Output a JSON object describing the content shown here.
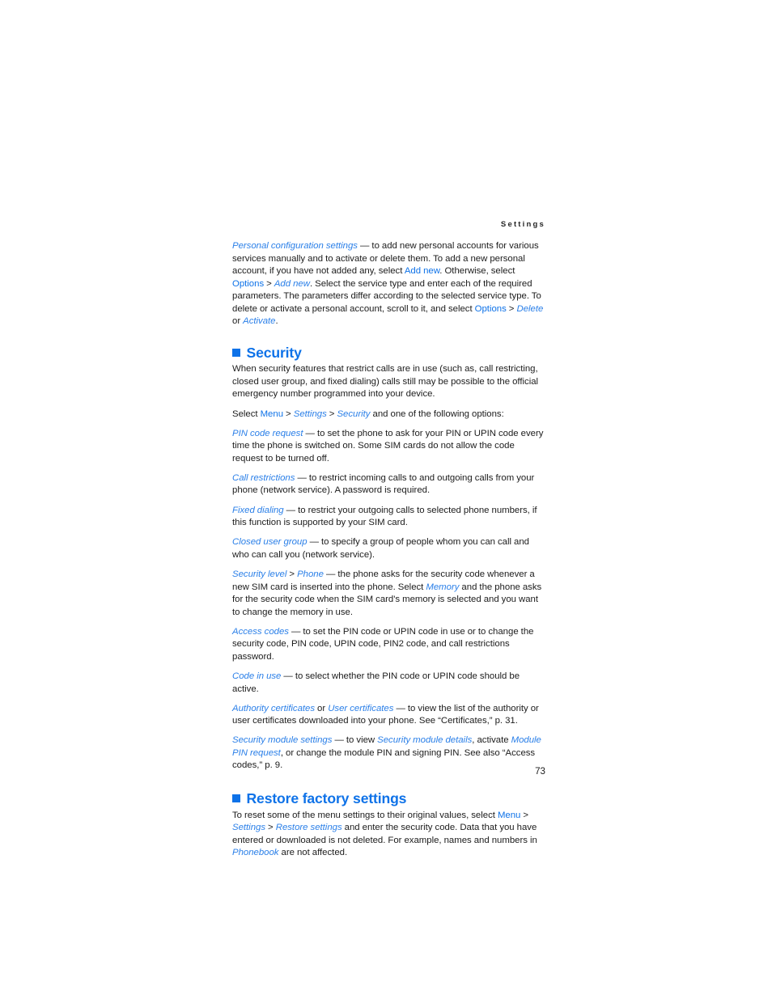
{
  "document": {
    "running_header": "Settings",
    "page_number": "73",
    "accent_color": "#0e72e8",
    "link_color": "#2a7fe8",
    "body_color": "#1c1c1c",
    "background_color": "#ffffff"
  },
  "intro_paragraph": {
    "term": "Personal configuration settings",
    "dash": " — ",
    "text_1": "to add new personal accounts for various services manually and to activate or delete them. To add a new personal account, if you have not added any, select ",
    "softkey_1": "Add new",
    "text_2": ". Otherwise, select ",
    "softkey_2": "Options",
    "sep_1": " > ",
    "menu_1": "Add new",
    "text_3": ". Select the service type and enter each of the required parameters. The parameters differ according to the selected service type. To delete or activate a personal account, scroll to it, and select ",
    "softkey_3": "Options",
    "sep_2": " > ",
    "menu_2": "Delete",
    "text_4": " or ",
    "menu_3": "Activate",
    "text_5": "."
  },
  "security_section": {
    "heading": "Security",
    "intro": "When security features that restrict calls are in use (such as, call restricting, closed user group, and fixed dialing) calls still may be possible to the official emergency number programmed into your device.",
    "path_lead": "Select ",
    "path_menu": "Menu",
    "path_sep_1": " > ",
    "path_settings": "Settings",
    "path_sep_2": " > ",
    "path_security": "Security",
    "path_tail": " and one of the following options:",
    "items": [
      {
        "term": "PIN code request",
        "dash": " — ",
        "text": "to set the phone to ask for your PIN or UPIN code every time the phone is switched on. Some SIM cards do not allow the code request to be turned off."
      },
      {
        "term": "Call restrictions",
        "dash": " — ",
        "text": "to restrict incoming calls to and outgoing calls from your phone (network service). A password is required."
      },
      {
        "term": "Fixed dialing",
        "dash": " — ",
        "text": "to restrict your outgoing calls to selected phone numbers, if this function is supported by your SIM card."
      },
      {
        "term": "Closed user group",
        "dash": " — ",
        "text": "to specify a group of people whom you can call and who can call you (network service)."
      }
    ],
    "security_level": {
      "term": "Security level",
      "sep": " > ",
      "term_2": "Phone",
      "dash": " — ",
      "text_1": "the phone asks for the security code whenever a new SIM card is inserted into the phone. Select ",
      "menu": "Memory",
      "text_2": " and the phone asks for the security code when the SIM card's memory is selected and you want to change the memory in use."
    },
    "access_codes": {
      "term": "Access codes",
      "dash": " — ",
      "text": "to set the PIN code or UPIN code in use or to change the security code, PIN code, UPIN code, PIN2 code, and call restrictions password."
    },
    "code_in_use": {
      "term": "Code in use",
      "dash": " — ",
      "text": "to select whether the PIN code or UPIN code should be active."
    },
    "certificates": {
      "term_1": "Authority certificates",
      "conj": " or ",
      "term_2": "User certificates",
      "dash": " — ",
      "text": "to view the list of the authority or user certificates downloaded into your phone. See “Certificates,” p. 31."
    },
    "security_module": {
      "term_1": "Security module settings",
      "dash": " — ",
      "text_1": "to view ",
      "term_2": "Security module details",
      "text_2": ", activate ",
      "term_3": "Module PIN request",
      "text_3": ", or change the module PIN and signing PIN. See also “Access codes,” p. 9."
    }
  },
  "restore_section": {
    "heading": "Restore factory settings",
    "text_1": "To reset some of the menu settings to their original values, select ",
    "menu_1": "Menu",
    "sep_1": " > ",
    "menu_2": "Settings",
    "sep_2": " > ",
    "menu_3": "Restore settings",
    "text_2": " and enter the security code. Data that you have entered or downloaded is not deleted. For example, names and numbers in ",
    "menu_4": "Phonebook",
    "text_3": " are not affected."
  }
}
